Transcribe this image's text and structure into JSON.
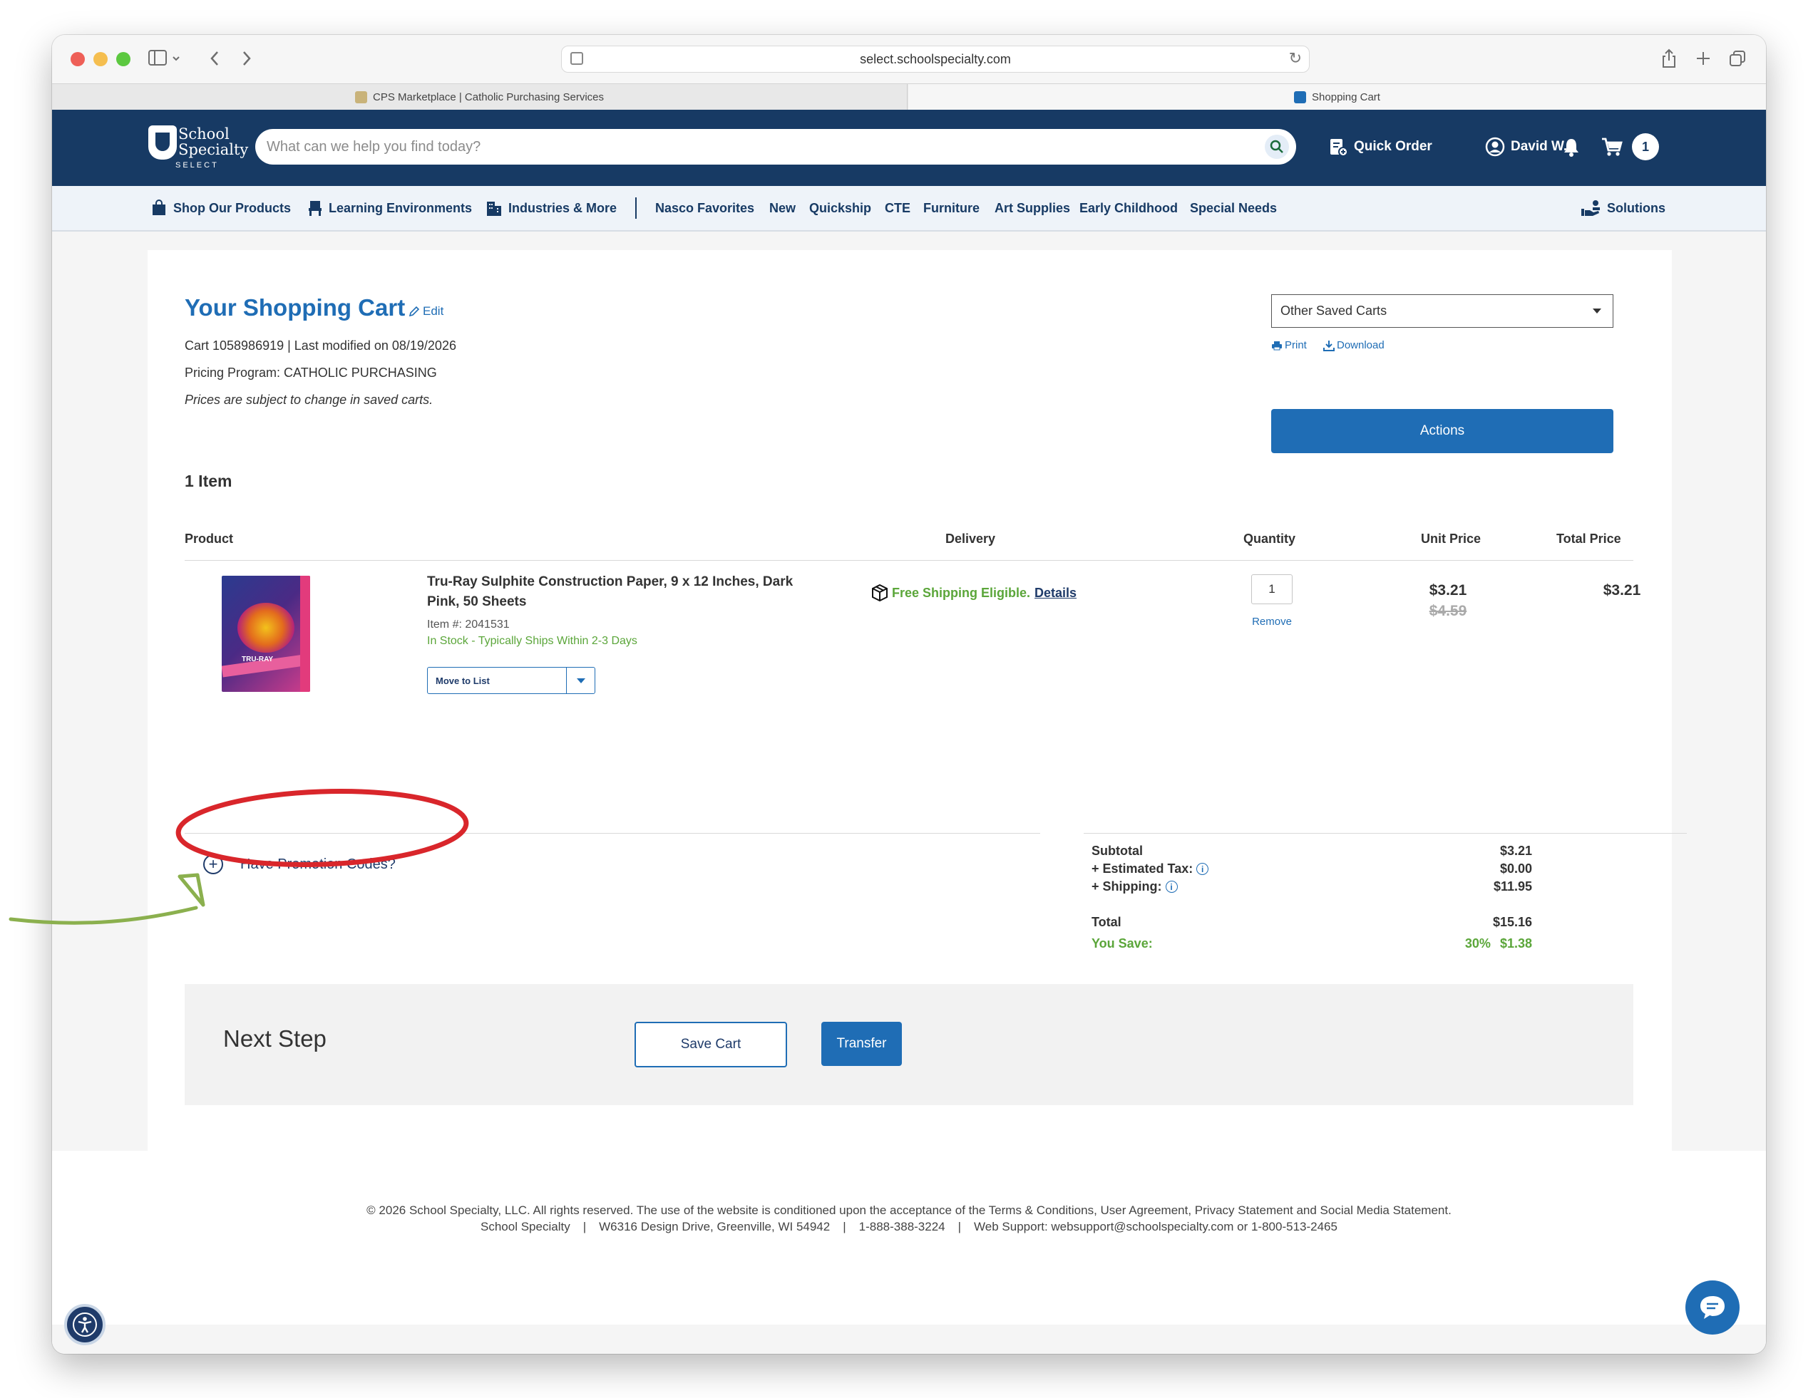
{
  "browser": {
    "url": "select.schoolspecialty.com",
    "tabs": [
      {
        "label": "CPS Marketplace | Catholic Purchasing Services"
      },
      {
        "label": "Shopping Cart"
      }
    ]
  },
  "header": {
    "logo_line1": "School",
    "logo_line2": "Specialty",
    "logo_line3": "SELECT",
    "search_placeholder": "What can we help you find today?",
    "quick_order": "Quick Order",
    "user_name": "David W.",
    "cart_count": "1"
  },
  "nav": {
    "items": [
      "Shop Our Products",
      "Learning Environments",
      "Industries & More",
      "Nasco Favorites",
      "New",
      "Quickship",
      "CTE",
      "Furniture",
      "Art Supplies",
      "Early Childhood",
      "Special Needs"
    ],
    "solutions": "Solutions"
  },
  "cart": {
    "title": "Your Shopping Cart",
    "edit": "Edit",
    "cart_info": "Cart 1058986919 | Last modified on 08/19/2026",
    "pricing_program": "Pricing Program: CATHOLIC PURCHASING",
    "price_note": "Prices are subject to change in saved carts.",
    "items_count": "1 Item",
    "saved_carts": "Other Saved Carts",
    "print": "Print",
    "download": "Download",
    "actions": "Actions"
  },
  "table": {
    "headers": [
      "Product",
      "Delivery",
      "Quantity",
      "Unit Price",
      "Total Price"
    ],
    "rows": [
      {
        "name": "Tru-Ray Sulphite Construction Paper, 9 x 12 Inches, Dark Pink, 50 Sheets",
        "item_number": "Item #: 2041531",
        "stock": "In Stock - Typically Ships Within 2-3 Days",
        "move_to_list": "Move to List",
        "delivery": "Free Shipping Eligible.",
        "delivery_details": "Details",
        "quantity": "1",
        "remove": "Remove",
        "unit_price": "$3.21",
        "original_price": "$4.59",
        "total_price": "$3.21",
        "image_brand": "TRU-RAY"
      }
    ]
  },
  "promo": {
    "label": "Have Promotion Codes?"
  },
  "summary": {
    "subtotal_label": "Subtotal",
    "subtotal": "$3.21",
    "tax_label": "+ Estimated Tax:",
    "tax": "$0.00",
    "shipping_label": "+ Shipping:",
    "shipping": "$11.95",
    "total_label": "Total",
    "total": "$15.16",
    "save_label": "You Save:",
    "save_percent": "30%",
    "save_amount": "$1.38"
  },
  "next_step": {
    "title": "Next Step",
    "save_cart": "Save Cart",
    "transfer": "Transfer"
  },
  "footer": {
    "line1": "© 2026 School Specialty, LLC. All rights reserved. The use of the website is conditioned upon the acceptance of the Terms & Conditions, User Agreement, Privacy Statement and Social Media Statement.",
    "company": "School Specialty",
    "address": "W6316 Design Drive, Greenville, WI 54942",
    "phone": "1-888-388-3224",
    "support": "Web Support: websupport@schoolspecialty.com or 1-800-513-2465"
  },
  "colors": {
    "brand_navy": "#173a64",
    "brand_blue": "#1f6db5",
    "success_green": "#5ba63a",
    "annotation_red": "#d9262b",
    "annotation_green": "#8bb04e"
  }
}
